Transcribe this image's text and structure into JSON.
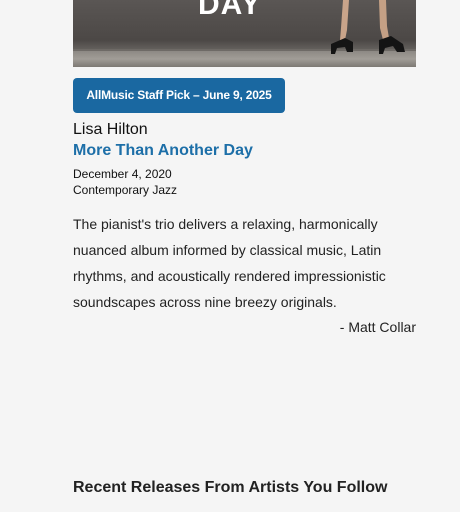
{
  "album_art": {
    "cover_text": "DAY"
  },
  "staff_pick": {
    "label": "AllMusic Staff Pick – June 9, 2025"
  },
  "album": {
    "artist": "Lisa Hilton",
    "title": "More Than Another Day",
    "release_date": "December 4, 2020",
    "genre": "Contemporary Jazz"
  },
  "review": {
    "text": "The pianist's trio delivers a relaxing, harmonically nuanced album informed by classical music, Latin rhythms, and acoustically rendered impressionistic soundscapes across nine breezy originals.",
    "author": "- Matt Collar"
  },
  "sections": {
    "recent_releases_heading": "Recent Releases From Artists You Follow"
  },
  "colors": {
    "background": "#f5f5f5",
    "staff_pick_bg": "#1a68a1",
    "link": "#1d6fa8"
  }
}
